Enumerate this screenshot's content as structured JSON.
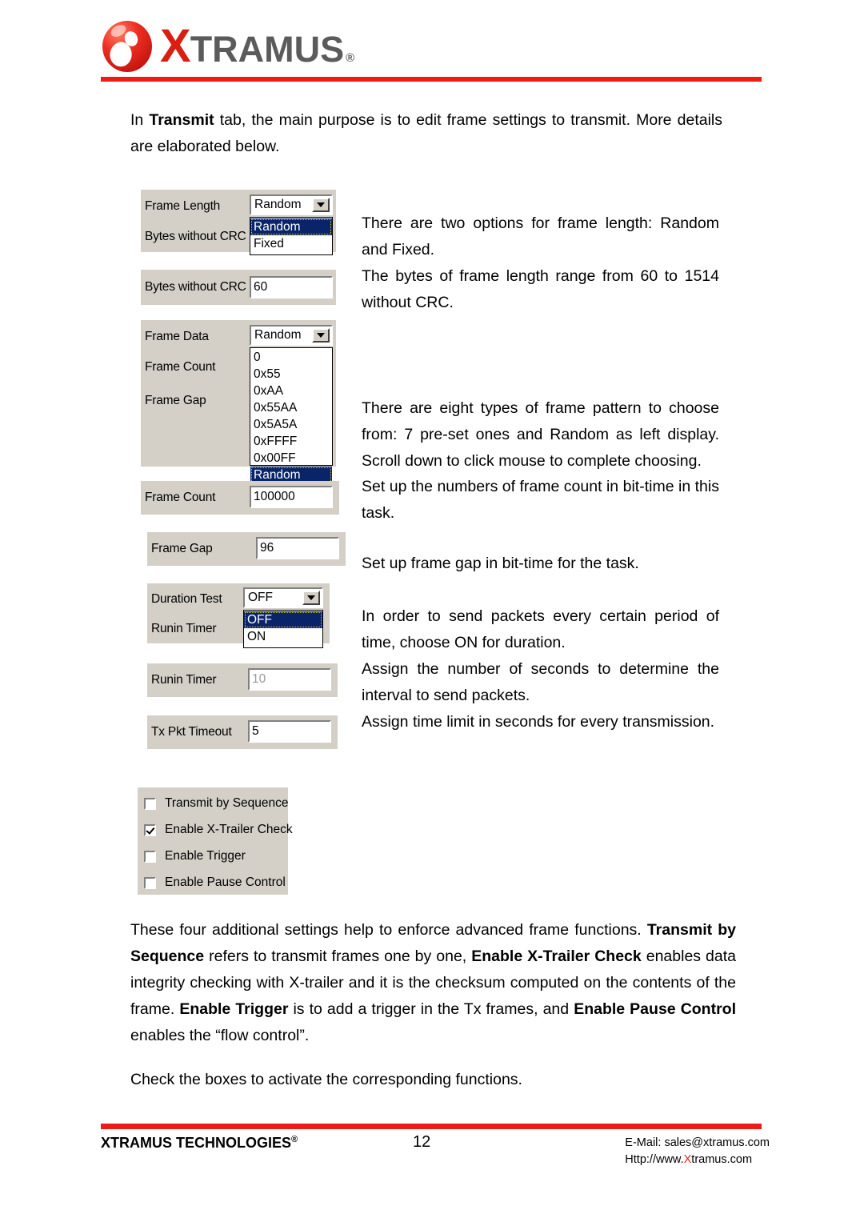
{
  "header": {
    "logo_x": "X",
    "logo_rest": "TRAMUS",
    "logo_reg": "®",
    "logo_alt": "xtramus-logo"
  },
  "intro": {
    "line_pre": "In ",
    "bold": "Transmit",
    "line_post": " tab, the main purpose is to edit frame settings to transmit. More details are elaborated below."
  },
  "widgets": {
    "frame_length": {
      "label": "Frame Length",
      "second_label": "Bytes without CRC",
      "value": "Random",
      "options": [
        "Random",
        "Fixed"
      ],
      "selected_index": 0
    },
    "bytes_without_crc": {
      "label": "Bytes without CRC",
      "value": "60"
    },
    "frame_data": {
      "label": "Frame Data",
      "second_label": "Frame Count",
      "third_label": "Frame Gap",
      "value": "Random",
      "options": [
        "0",
        "0x55",
        "0xAA",
        "0x55AA",
        "0x5A5A",
        "0xFFFF",
        "0x00FF",
        "Random"
      ],
      "selected_index": 7
    },
    "frame_count": {
      "label": "Frame Count",
      "value": "100000"
    },
    "frame_gap": {
      "label": "Frame Gap",
      "value": "96"
    },
    "duration_test": {
      "label": "Duration Test",
      "second_label": "Runin Timer",
      "value": "OFF",
      "options": [
        "OFF",
        "ON"
      ],
      "selected_index": 0
    },
    "runin_timer": {
      "label": "Runin Timer",
      "value": "10"
    },
    "tx_pkt_timeout": {
      "label": "Tx Pkt Timeout",
      "value": "5"
    },
    "checkboxes": [
      {
        "label": "Transmit by Sequence",
        "checked": false
      },
      {
        "label": "Enable X-Trailer Check",
        "checked": true
      },
      {
        "label": "Enable Trigger",
        "checked": false
      },
      {
        "label": "Enable Pause Control",
        "checked": false
      }
    ]
  },
  "notes": {
    "frame_length": "There are two options for frame length: Random and Fixed.",
    "bytes_crc": "The bytes of frame length range from 60 to 1514 without CRC.",
    "frame_data": "There are eight types of frame pattern to choose from: 7 pre-set ones and Random as left display. Scroll down to click mouse to complete choosing.",
    "frame_count": "Set up the numbers of frame count in bit-time in this task.",
    "frame_gap": "Set up frame gap in bit-time for the task.",
    "duration_test": "In order to send packets every certain period of time, choose ON for duration.",
    "runin_timer": "Assign the number of seconds to determine the interval to send packets.",
    "tx_pkt_timeout": "Assign time limit in seconds for every transmission."
  },
  "bottom": {
    "s1": "These four additional settings help to enforce advanced frame functions. ",
    "b1": "Transmit by Sequence",
    "s2": " refers to transmit frames one by one, ",
    "b2": "Enable X-Trailer Check",
    "s3": " enables data integrity checking with X-trailer and it is the checksum computed on the contents of the frame. ",
    "b3": "Enable Trigger",
    "s4": " is to add a trigger in the Tx frames, and ",
    "b4": "Enable Pause Control",
    "s5": " enables the “flow control”.",
    "closing": "Check the boxes to activate the corresponding functions."
  },
  "footer": {
    "company": "XTRAMUS TECHNOLOGIES",
    "company_reg": "®",
    "page_number": "12",
    "email": "E-Mail: sales@xtramus.com",
    "url_pre": "Http://www.",
    "url_x": "X",
    "url_post": "tramus.com"
  },
  "colors": {
    "brand_red": "#ee1c16",
    "panel_gray": "#d4d0c8",
    "highlight_blue": "#0a246a"
  }
}
